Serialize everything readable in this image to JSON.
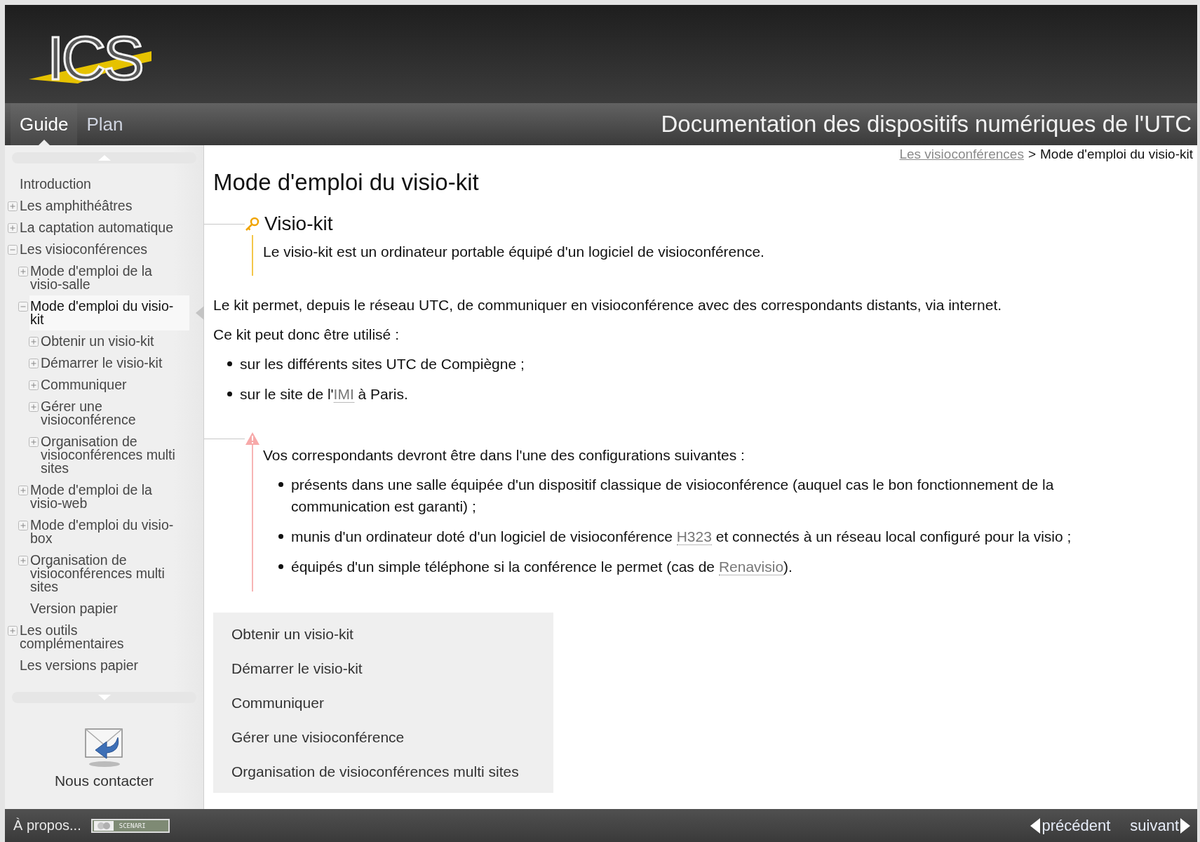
{
  "logo": {
    "text": "ICS"
  },
  "tabs": [
    {
      "label": "Guide",
      "selected": true
    },
    {
      "label": "Plan",
      "selected": false
    }
  ],
  "site_title": "Documentation des dispositifs numériques de l'UTC",
  "sidebar": {
    "items": [
      {
        "kind": "leaf",
        "label": "Introduction",
        "selected": false
      },
      {
        "kind": "toggle",
        "label": "Les amphithéâtres",
        "expanded": false,
        "selected": false
      },
      {
        "kind": "toggle",
        "label": "La captation automatique",
        "expanded": false,
        "selected": false
      },
      {
        "kind": "toggle",
        "label": "Les visioconférences",
        "expanded": true,
        "selected": false,
        "children": [
          {
            "kind": "toggle",
            "label": "Mode d'emploi de la visio-salle",
            "expanded": false,
            "selected": false
          },
          {
            "kind": "toggle",
            "label": "Mode d'emploi du visio-kit",
            "expanded": true,
            "selected": true,
            "children": [
              {
                "kind": "toggle",
                "label": "Obtenir un visio-kit",
                "expanded": false,
                "selected": false
              },
              {
                "kind": "toggle",
                "label": "Démarrer le visio-kit",
                "expanded": false,
                "selected": false
              },
              {
                "kind": "toggle",
                "label": "Communiquer",
                "expanded": false,
                "selected": false
              },
              {
                "kind": "toggle",
                "label": "Gérer une visioconférence",
                "expanded": false,
                "selected": false
              },
              {
                "kind": "toggle",
                "label": "Organisation de visioconférences multi sites",
                "expanded": false,
                "selected": false
              }
            ]
          },
          {
            "kind": "toggle",
            "label": "Mode d'emploi de la visio-web",
            "expanded": false,
            "selected": false
          },
          {
            "kind": "toggle",
            "label": "Mode d'emploi du visio-box",
            "expanded": false,
            "selected": false
          },
          {
            "kind": "toggle",
            "label": "Organisation de visioconférences multi sites",
            "expanded": false,
            "selected": false
          },
          {
            "kind": "leaf",
            "label": "Version papier",
            "selected": false
          }
        ]
      },
      {
        "kind": "toggle",
        "label": "Les outils complémentaires",
        "expanded": false,
        "selected": false
      },
      {
        "kind": "leaf",
        "label": "Les versions papier",
        "selected": false
      }
    ],
    "contact": {
      "label": "Nous contacter"
    }
  },
  "breadcrumb": {
    "link": "Les visioconférences",
    "separator": ">",
    "current": "Mode d'emploi du visio-kit"
  },
  "page_title": "Mode d'emploi du visio-kit",
  "definition": {
    "title": "Visio-kit",
    "text": "Le visio-kit est un ordinateur portable équipé d'un logiciel de visioconférence."
  },
  "paragraphs": [
    "Le kit permet, depuis le réseau UTC, de communiquer en visioconférence avec des correspondants distants, via internet.",
    "Ce kit peut donc être utilisé :"
  ],
  "uses": [
    {
      "parts": [
        {
          "kind": "text",
          "text": "sur les différents sites UTC de Compiègne ;"
        }
      ]
    },
    {
      "parts": [
        {
          "kind": "text",
          "text": "sur le site de l'"
        },
        {
          "kind": "abbr",
          "text": "IMI"
        },
        {
          "kind": "text",
          "text": " à Paris."
        }
      ]
    }
  ],
  "warning": {
    "text": "Vos correspondants devront être dans l'une des configurations suivantes :",
    "items": [
      {
        "parts": [
          {
            "kind": "text",
            "text": "présents dans une salle équipée d'un dispositif classique de visioconférence (auquel cas le bon fonctionnement de la communication est garanti) ;"
          }
        ]
      },
      {
        "parts": [
          {
            "kind": "text",
            "text": "munis d'un ordinateur doté d'un logiciel de visioconférence "
          },
          {
            "kind": "abbr",
            "text": "H323"
          },
          {
            "kind": "text",
            "text": " et connectés à un réseau local configuré pour la visio ;"
          }
        ]
      },
      {
        "parts": [
          {
            "kind": "text",
            "text": "équipés d'un simple téléphone si la conférence le permet (cas de "
          },
          {
            "kind": "link",
            "text": "Renavisio"
          },
          {
            "kind": "text",
            "text": ")."
          }
        ]
      }
    ]
  },
  "subpages": [
    "Obtenir un visio-kit",
    "Démarrer le visio-kit",
    "Communiquer",
    "Gérer une visioconférence",
    "Organisation de visioconférences multi sites"
  ],
  "footer": {
    "about": "À propos...",
    "badge": "SCENARI",
    "prev": "précédent",
    "next": "suivant"
  }
}
